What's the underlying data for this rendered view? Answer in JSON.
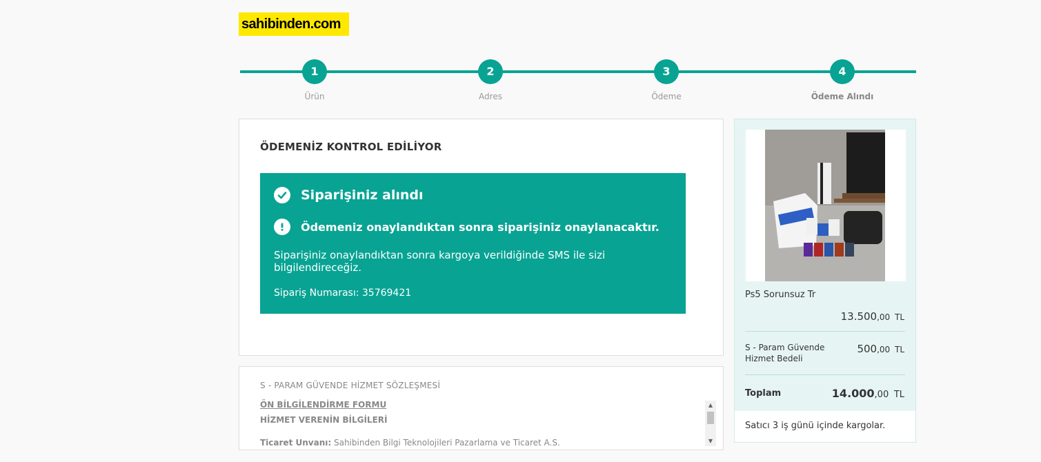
{
  "brand": {
    "logo_text": "sahibinden.com",
    "accent": "#08a393",
    "logo_bg": "#ffe800"
  },
  "steps": [
    {
      "number": "1",
      "label": "Ürün"
    },
    {
      "number": "2",
      "label": "Adres"
    },
    {
      "number": "3",
      "label": "Ödeme"
    },
    {
      "number": "4",
      "label": "Ödeme Alındı"
    }
  ],
  "main": {
    "title": "ÖDEMENİZ KONTROL EDİLİYOR",
    "notice": {
      "success_icon": "check-circle-icon",
      "success": "Siparişiniz alındı",
      "warning_icon": "exclamation-circle-icon",
      "warning": "Ödemeniz onaylandıktan sonra siparişiniz onaylanacaktır.",
      "description": "Siparişiniz onaylandıktan sonra kargoya verildiğinde SMS ile sizi bilgilendireceğiz.",
      "order_number": "Sipariş Numarası: 35769421"
    }
  },
  "contract": {
    "title": "S - PARAM GÜVENDE HİZMET SÖZLEŞMESİ",
    "form_title": "ÖN BİLGİLENDİRME FORMU",
    "section_title": "HİZMET VERENİN BİLGİLERİ",
    "field_label": "Ticaret Unvanı:",
    "field_value": "Sahibinden Bilgi Teknolojileri Pazarlama ve Ticaret A.S."
  },
  "summary": {
    "product_name": "Ps5 Sorunsuz Tr",
    "product_price": {
      "whole": "13.500",
      "decimal": ",00",
      "currency": "TL"
    },
    "fee_label": "S - Param Güvende Hizmet Bedeli",
    "fee_price": {
      "whole": "500",
      "decimal": ",00",
      "currency": "TL"
    },
    "total_label": "Toplam",
    "total_price": {
      "whole": "14.000",
      "decimal": ",00",
      "currency": "TL"
    },
    "cargo_note": "Satıcı 3 iş günü içinde kargolar."
  }
}
